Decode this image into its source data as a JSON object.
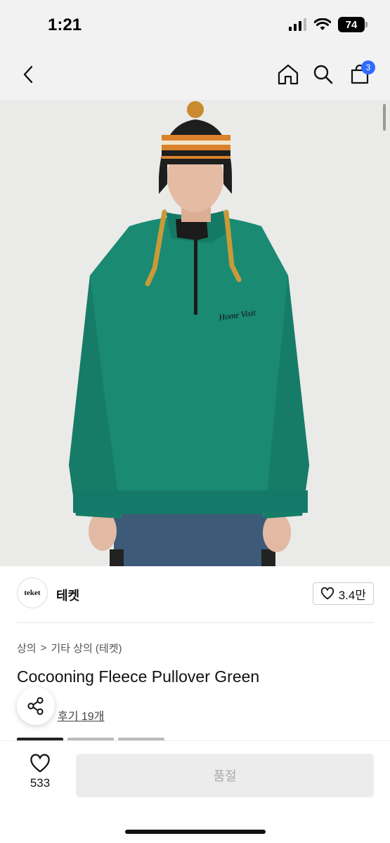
{
  "status_bar": {
    "time": "1:21",
    "battery": "74"
  },
  "nav": {
    "cart_count": "3"
  },
  "brand": {
    "logo_text": "teket",
    "name": "테켓",
    "likes": "3.4만"
  },
  "breadcrumb": {
    "category": "상의",
    "separator": ">",
    "subcategory": "기타 상의 (테켓)"
  },
  "product": {
    "title": "Cocooning Fleece Pullover Green",
    "reviews": "후기 19개"
  },
  "bottom": {
    "wish_count": "533",
    "soldout_label": "품절"
  },
  "colors": {
    "fleece": "#1a8a73",
    "badge": "#2f6bff",
    "soldout_bg": "#ececec"
  },
  "icons": [
    "back-icon",
    "home-icon",
    "search-icon",
    "cart-icon",
    "heart-icon",
    "share-icon"
  ]
}
